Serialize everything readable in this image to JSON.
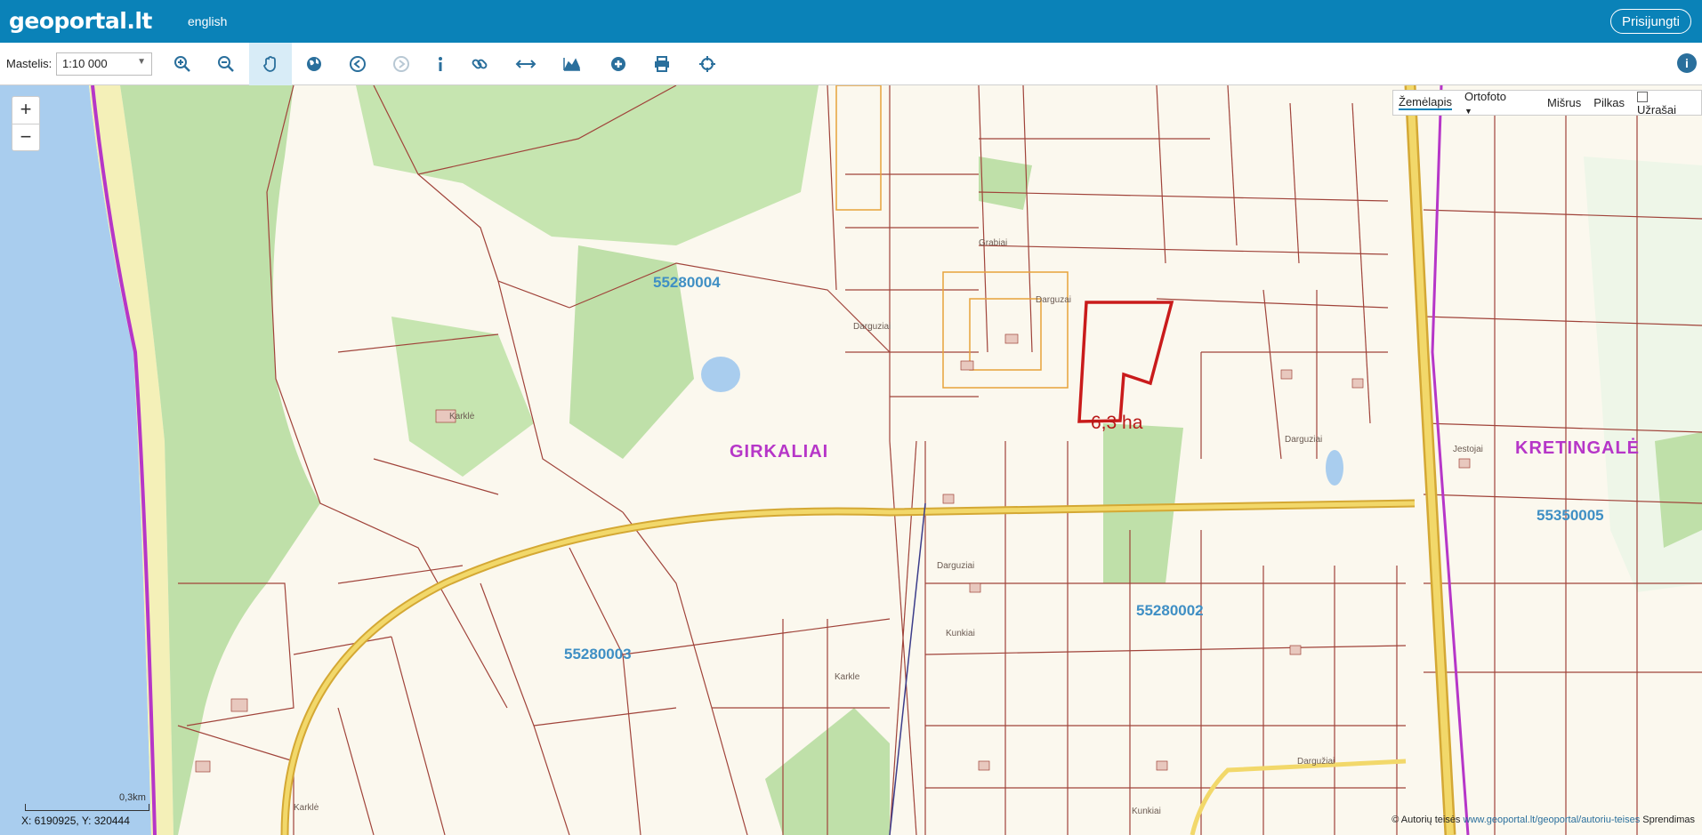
{
  "header": {
    "logo": "geoportal.lt",
    "language": "english",
    "login_label": "Prisijungti"
  },
  "toolbar": {
    "scale_label": "Mastelis:",
    "scale_value": "1:10 000",
    "tools": [
      {
        "name": "zoom-in-icon",
        "glyph": "⊕"
      },
      {
        "name": "zoom-out-icon",
        "glyph": "⊖"
      },
      {
        "name": "pan-hand-icon",
        "glyph": "✋",
        "active": true
      },
      {
        "name": "globe-icon",
        "glyph": "🌐"
      },
      {
        "name": "back-icon",
        "glyph": "◀"
      },
      {
        "name": "forward-icon",
        "glyph": "▶",
        "disabled": true
      },
      {
        "name": "info-icon",
        "glyph": "ℹ"
      },
      {
        "name": "link-icon",
        "glyph": "🔗"
      },
      {
        "name": "measure-icon",
        "glyph": "↔"
      },
      {
        "name": "profile-icon",
        "glyph": "▲"
      },
      {
        "name": "add-icon",
        "glyph": "+"
      },
      {
        "name": "print-icon",
        "glyph": "🖶"
      },
      {
        "name": "locate-icon",
        "glyph": "⌖"
      }
    ]
  },
  "map_controls": {
    "zoom_in": "+",
    "zoom_out": "−"
  },
  "layers": {
    "items": [
      "Žemėlapis",
      "Ortofoto",
      "Mišrus",
      "Pilkas"
    ],
    "selected": "Žemėlapis",
    "labels_toggle": "Užrašai"
  },
  "map_labels": {
    "parcels": [
      "55280004",
      "55280003",
      "55280002",
      "55350005"
    ],
    "villages": [
      "GIRKALIAI",
      "KRETINGALĖ"
    ],
    "streets": [
      "Karklė",
      "Grabiai",
      "Darguzai",
      "Darguziai",
      "Darguziai",
      "Karkle",
      "Kunkiai",
      "Kunkiai",
      "Darguziai",
      "Dargužiai",
      "Jestojai",
      "Karklė"
    ],
    "area": "6,3 ha"
  },
  "scale": {
    "bar_label": "0,3km"
  },
  "coordinates": {
    "text": "X: 6190925, Y: 320444"
  },
  "copyright": {
    "prefix": "© Autorių teisės",
    "link": "www.geoportal.lt/geoportal/autoriu-teises",
    "suffix": "Sprendimas"
  },
  "colors": {
    "header_bg": "#0a82b8",
    "parcel_line": "#a0433a",
    "road_yellow": "#e9c44a",
    "forest_green": "#bfe0a9",
    "sea_blue": "#a9cdee",
    "boundary_purple": "#b636c8",
    "area_red": "#c91b1b"
  }
}
